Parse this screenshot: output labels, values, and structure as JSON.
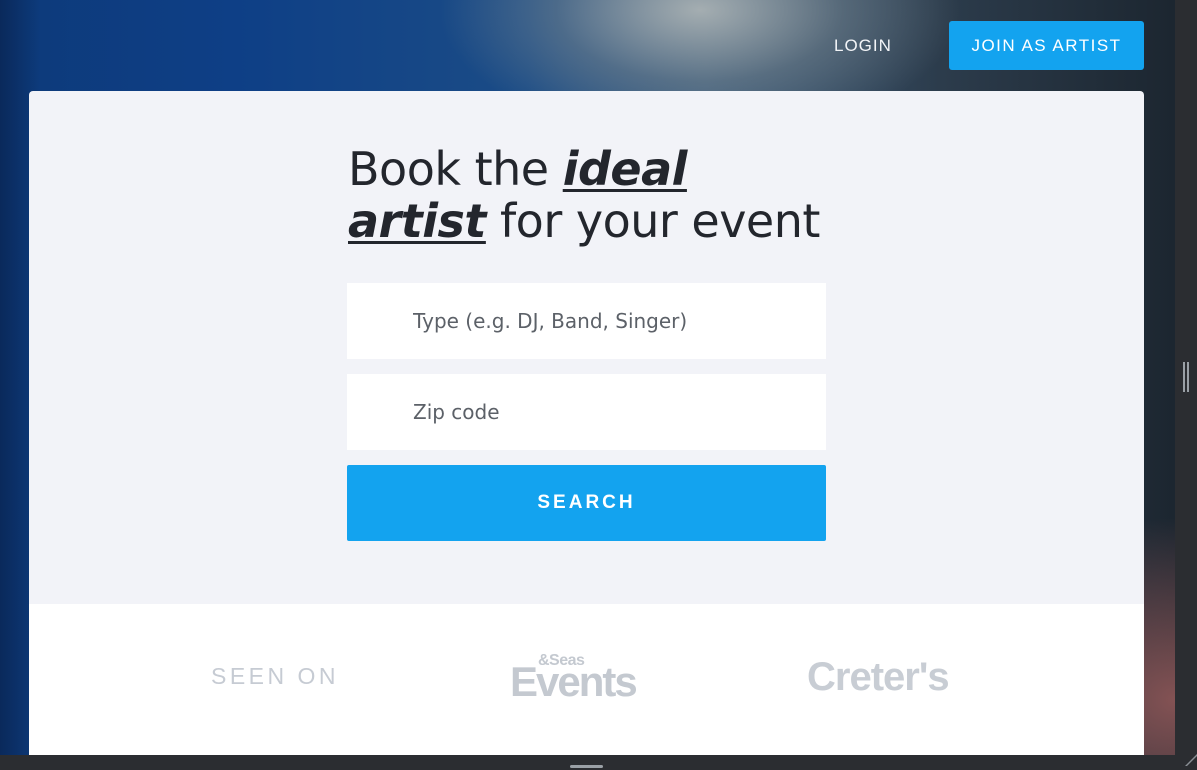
{
  "header": {
    "login_label": "LOGIN",
    "join_label": "JOIN AS ARTIST"
  },
  "hero": {
    "headline_part1": "Book the ",
    "headline_emph1": "ideal",
    "headline_emph2": "artist",
    "headline_part2": " for your event"
  },
  "search_form": {
    "type_placeholder": "Type (e.g. DJ, Band, Singer)",
    "type_value": "",
    "zip_placeholder": "Zip code",
    "zip_value": "",
    "search_label": "SEARCH"
  },
  "seen_on": {
    "label": "SEEN ON",
    "logos": [
      {
        "small": "&Seas",
        "big": "Events"
      },
      {
        "text": "Creter's"
      }
    ]
  },
  "colors": {
    "accent": "#13a3ef",
    "card_bg": "#f2f3f8",
    "headline": "#23262d"
  }
}
